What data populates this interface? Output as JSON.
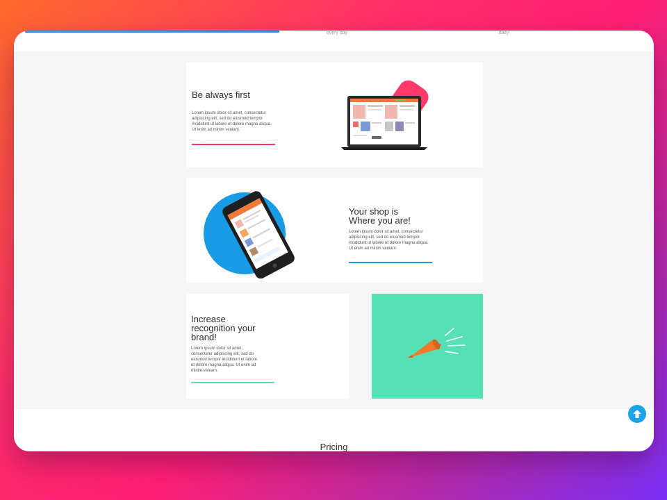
{
  "stats": {
    "left_caption": "every day",
    "right_caption": "daily"
  },
  "features": [
    {
      "title": "Be always first",
      "body": "Lorem ipsum dolor sit amet, consectetur adipiscing elit, sed do eiusmod tempor incididunt ut labore et dolore magna aliqua. Ut enim ad minim veniam.",
      "accent": "#ff3b6b"
    },
    {
      "title_line1": "Your shop is",
      "title_line2": "Where you are!",
      "body": "Lorem ipsum dolor sit amet, consectetur adipiscing elit, sed do eiusmod tempor incididunt ut labore et dolore magna aliqua. Ut enim ad minim veniam.",
      "accent": "#1a9be6"
    },
    {
      "title_line1": "Increase",
      "title_line2": "recognition your",
      "title_line3": "brand!",
      "body": "Lorem ipsum dolor sit amet, consectetur adipiscing elit, sed do eiusmod tempor incididunt ut labore et dolore magna aliqua. Ut enim ad minim veniam.",
      "accent": "#55e0b5"
    }
  ],
  "pricing": {
    "heading": "Pricing"
  },
  "colors": {
    "tile_green": "#55e0b5",
    "circle_blue": "#1a9be6",
    "blob_pink": "#ff3b6b",
    "back_to_top": "#1aa3e6"
  },
  "icons": {
    "back_to_top": "arrow-up-icon"
  }
}
